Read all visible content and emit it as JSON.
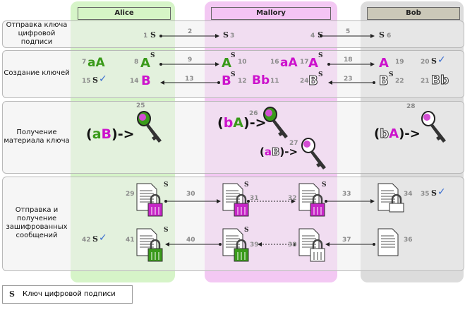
{
  "lanes": {
    "alice": "Alice",
    "mallory": "Mallory",
    "bob": "Bob"
  },
  "rows": {
    "r1": "Отправка ключа цифровой подписи",
    "r2": "Создание ключей",
    "r3": "Получение материала ключа",
    "r4": "Отправка и получение зашифрованных сообщений"
  },
  "steps": [
    "1",
    "2",
    "3",
    "4",
    "5",
    "6",
    "7",
    "8",
    "9",
    "10",
    "11",
    "12",
    "13",
    "14",
    "15",
    "16",
    "17",
    "18",
    "19",
    "20",
    "21",
    "22",
    "23",
    "24",
    "25",
    "26",
    "27",
    "28",
    "29",
    "30",
    "31",
    "32",
    "33",
    "34",
    "35",
    "36",
    "37",
    "38",
    "39",
    "40",
    "41",
    "42"
  ],
  "glyphs": {
    "s": "S",
    "aA": "aA",
    "bb": "Bb",
    "A": "A",
    "B": "B",
    "arrow": "->",
    "paren_open": "(",
    "paren_close": ")",
    "a": "a",
    "b": "b"
  },
  "legend": {
    "symbol": "S",
    "text": "Ключ цифровой подписи"
  },
  "colors": {
    "green": "#3a9a1a",
    "magenta": "#cc12cc",
    "alice_bg": "#d9f5cc",
    "mallory_bg": "#f2c7f2",
    "bob_bg": "#dadada"
  }
}
